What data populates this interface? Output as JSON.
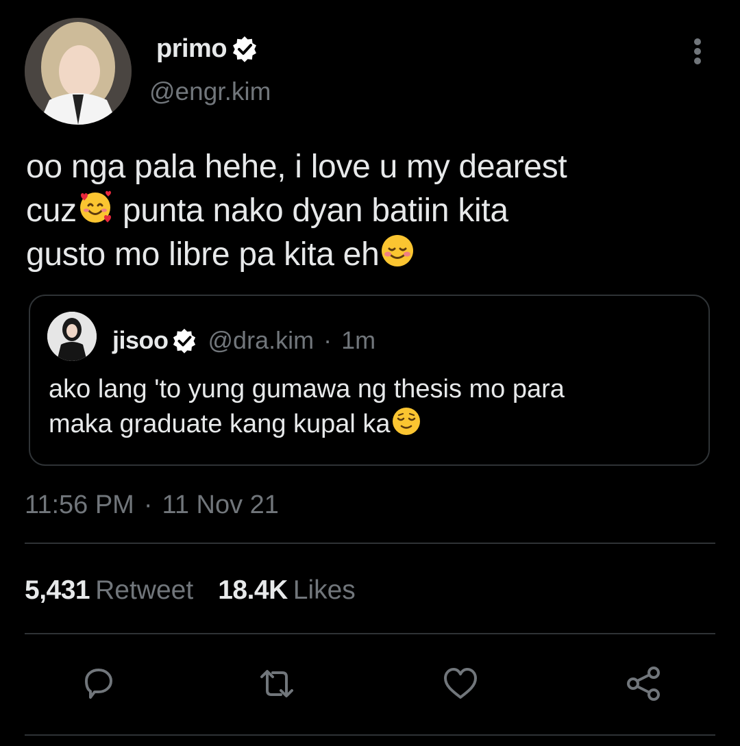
{
  "author": {
    "display_name": "primo",
    "handle": "@engr.kim",
    "avatar": "avatar"
  },
  "tweet": {
    "line1": "oo nga pala hehe, i love u my dearest",
    "line2a": "cuz",
    "line2b": " punta nako dyan batiin kita",
    "line3": "gusto mo libre pa kita eh",
    "emoji1": "smiling-face-with-hearts-emoji",
    "emoji2": "smiling-face-emoji"
  },
  "quote": {
    "display_name": "jisoo",
    "handle": "@dra.kim",
    "dot": "·",
    "time": "1m",
    "line1": "ako lang 'to yung gumawa ng thesis mo para",
    "line2": "maka graduate kang kupal ka",
    "emoji": "relieved-face-emoji"
  },
  "timestamp": {
    "time": "11:56 PM",
    "sep": "·",
    "date": "11 Nov 21"
  },
  "stats": {
    "retweets": "5,431",
    "retweets_label": "Retweet",
    "likes": "18.4K",
    "likes_label": "Likes"
  },
  "actions": [
    "reply-icon",
    "retweet-icon",
    "like-icon",
    "share-icon"
  ],
  "colors": {
    "background": "#000000",
    "text": "#e7e9ea",
    "secondary": "#71767b",
    "border": "#2f3336",
    "verified": "#ffffff"
  }
}
